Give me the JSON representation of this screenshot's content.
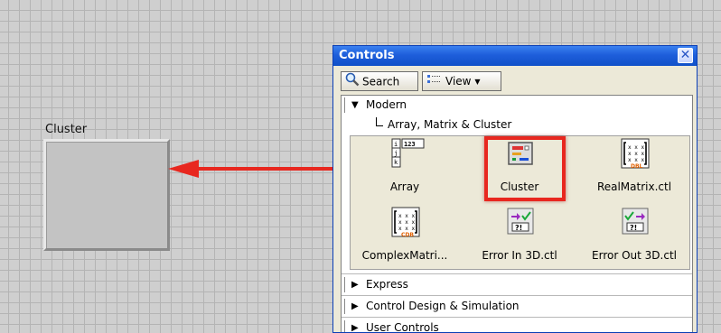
{
  "front_panel": {
    "cluster_label": "Cluster"
  },
  "palette": {
    "title": "Controls",
    "toolbar": {
      "search_label": "Search",
      "view_label": "View"
    },
    "modern": {
      "label": "Modern",
      "subcategory": "Array, Matrix & Cluster"
    },
    "items": [
      {
        "name": "Array",
        "icon": "array-icon"
      },
      {
        "name": "Cluster",
        "icon": "cluster-icon"
      },
      {
        "name": "RealMatrix.ctl",
        "icon": "real-matrix-icon"
      },
      {
        "name": "ComplexMatri...",
        "icon": "complex-matrix-icon"
      },
      {
        "name": "Error In 3D.ctl",
        "icon": "error-in-icon"
      },
      {
        "name": "Error Out 3D.ctl",
        "icon": "error-out-icon"
      }
    ],
    "categories": [
      {
        "label": "Express"
      },
      {
        "label": "Control Design & Simulation"
      },
      {
        "label": "User Controls"
      }
    ]
  },
  "colors": {
    "arrow": "#e8271f",
    "titlebar": "#1e5edb"
  }
}
